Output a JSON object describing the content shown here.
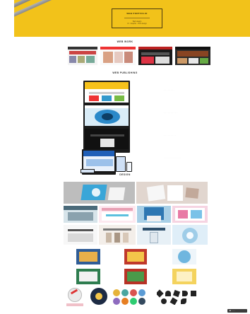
{
  "hero": {
    "title": "WEB PORTFOLIO",
    "subtitle_line1": "Web design",
    "subtitle_line2": "UI · Graphic · Print design"
  },
  "sections": {
    "web_work": "WEB WORK",
    "web_publishing": "WEB PUBLISHING",
    "design": "DESIGN"
  },
  "monitors": [
    {
      "caption": "· · · · · · · ·",
      "screen_color": "#f6c21b"
    },
    {
      "caption": "· · · · · · · · · ·",
      "screen_color": "#2b89c9"
    },
    {
      "caption": "· · · · · · · · ·",
      "screen_color": "#111111"
    },
    {
      "caption": "· · · · · · · · · · · ·",
      "screen_color": "#1f5fb8"
    }
  ],
  "footer": {
    "note": "",
    "badge": "■ ·····"
  },
  "colors": {
    "hero_bg": "#f2c21a",
    "accent_blue": "#2b89c9",
    "accent_pink": "#e8a0b4"
  }
}
